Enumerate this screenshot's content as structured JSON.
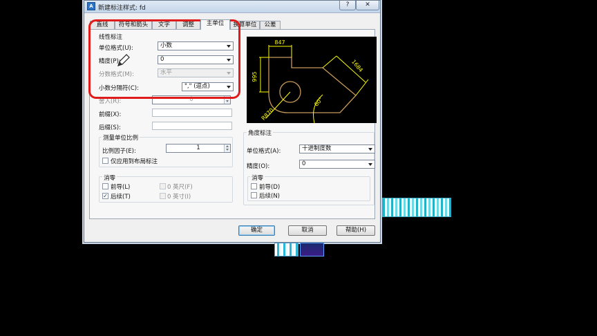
{
  "window": {
    "title": "新建标注样式: fd",
    "help": "?",
    "close": "✕"
  },
  "tabs": [
    "直线",
    "符号和箭头",
    "文字",
    "调整",
    "主单位",
    "换算单位",
    "公差"
  ],
  "active_tab": "主单位",
  "linear": {
    "group_title": "线性标注",
    "unit_format_label": "单位格式(U):",
    "unit_format_value": "小数",
    "precision_label": "精度(P):",
    "precision_value": "0",
    "fraction_label": "分数格式(M):",
    "fraction_value": "水平",
    "decimal_sep_label": "小数分隔符(C):",
    "decimal_sep_value": "\",\" (逗点)",
    "round_label": "舍入(R):",
    "round_value": "0",
    "prefix_label": "前缀(X):",
    "suffix_label": "后缀(S):"
  },
  "scale": {
    "group_title": "测量单位比例",
    "factor_label": "比例因子(E):",
    "factor_value": "1",
    "layout_only_label": "仅应用到布局标注"
  },
  "zero_linear": {
    "group_title": "消零",
    "leading_label": "前导(L)",
    "trailing_label": "后续(T)",
    "feet_label": "0 英尺(F)",
    "inches_label": "0 英寸(I)",
    "trailing_checked_mark": "✓"
  },
  "angular": {
    "group_title": "角度标注",
    "unit_format_label": "单位格式(A):",
    "unit_format_value": "十进制度数",
    "precision_label": "精度(O):",
    "precision_value": "0"
  },
  "zero_angular": {
    "group_title": "消零",
    "leading_label": "前导(D)",
    "trailing_label": "后续(N)"
  },
  "preview_labels": {
    "top": "847",
    "left": "995",
    "right": "1684",
    "angle": "60°",
    "radius": "R870"
  },
  "buttons": {
    "ok": "确定",
    "cancel": "取消",
    "help": "帮助(H)"
  },
  "colors": {
    "highlight": "#e01b1b",
    "dimension": "#ffff00",
    "geometry": "#c89a5a"
  }
}
